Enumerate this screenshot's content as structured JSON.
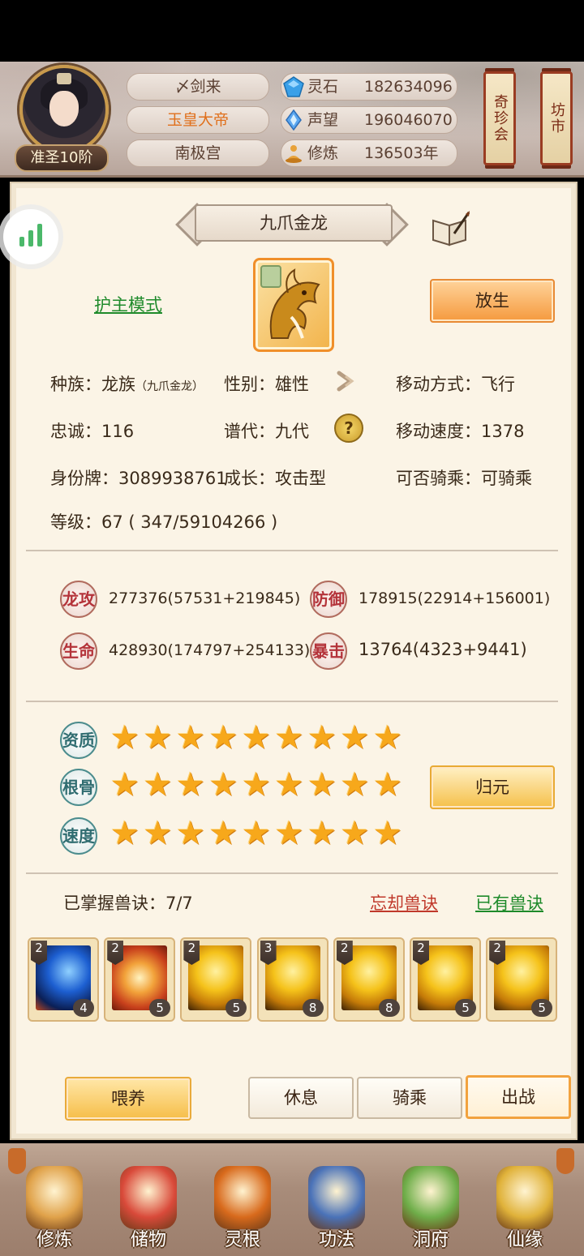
{
  "header": {
    "rank": "准圣10阶",
    "names": [
      "〆剑来",
      "玉皇大帝",
      "南极宫"
    ],
    "highlight_index": 1,
    "resources": [
      {
        "label": "灵石",
        "value": "182634096",
        "icon": "spirit-stone-icon"
      },
      {
        "label": "声望",
        "value": "196046070",
        "icon": "reputation-icon"
      },
      {
        "label": "修炼",
        "value": "136503年",
        "icon": "meditation-icon"
      }
    ],
    "side_scrolls": [
      "奇珍会",
      "坊市"
    ]
  },
  "pet": {
    "name": "九爪金龙",
    "mode_link": "护主模式",
    "release_button": "放生",
    "info": {
      "race_label": "种族：龙族",
      "race_sub": "（九爪金龙）",
      "gender": "性别：雄性",
      "move_type": "移动方式：飞行",
      "loyalty": "忠诚：116",
      "generation": "谱代：九代",
      "move_speed": "移动速度：1378",
      "id_tag": "身份牌：3089938761",
      "growth": "成长：攻击型",
      "rideable": "可否骑乘：可骑乘",
      "level": "等级：67 ( 347/59104266 )"
    },
    "stats": [
      {
        "icon_text": "龙攻",
        "value": "277376(57531+219845)"
      },
      {
        "icon_text": "防御",
        "value": "178915(22914+156001)"
      },
      {
        "icon_text": "生命",
        "value": "428930(174797+254133)"
      },
      {
        "icon_text": "暴击",
        "value": "13764(4323+9441)"
      }
    ],
    "aptitudes": [
      {
        "label": "资质",
        "stars": 9
      },
      {
        "label": "根骨",
        "stars": 9
      },
      {
        "label": "速度",
        "stars": 9
      }
    ],
    "reset_button": "归元",
    "skills_header": "已掌握兽诀：7/7",
    "forget_link": "忘却兽诀",
    "owned_link": "已有兽诀",
    "skills": [
      {
        "tier": "2",
        "level": "4",
        "color": "blue"
      },
      {
        "tier": "2",
        "level": "5",
        "color": "red"
      },
      {
        "tier": "2",
        "level": "5",
        "color": "gold"
      },
      {
        "tier": "3",
        "level": "8",
        "color": "gold"
      },
      {
        "tier": "2",
        "level": "8",
        "color": "gold"
      },
      {
        "tier": "2",
        "level": "5",
        "color": "gold"
      },
      {
        "tier": "2",
        "level": "5",
        "color": "gold"
      }
    ]
  },
  "actions": {
    "feed": "喂养",
    "rest": "休息",
    "ride": "骑乘",
    "deploy": "出战"
  },
  "bottom_nav": [
    {
      "label": "修炼",
      "icon": "cultivate-icon"
    },
    {
      "label": "储物",
      "icon": "storage-bag-icon"
    },
    {
      "label": "灵根",
      "icon": "spirit-root-icon"
    },
    {
      "label": "功法",
      "icon": "technique-book-icon"
    },
    {
      "label": "洞府",
      "icon": "cave-mansion-icon"
    },
    {
      "label": "仙缘",
      "icon": "fate-gourd-icon"
    }
  ],
  "colors": {
    "accent_orange": "#f59a3e",
    "link_green": "#1e8a2a",
    "link_red": "#c0392b",
    "star": "#f7a81b"
  }
}
